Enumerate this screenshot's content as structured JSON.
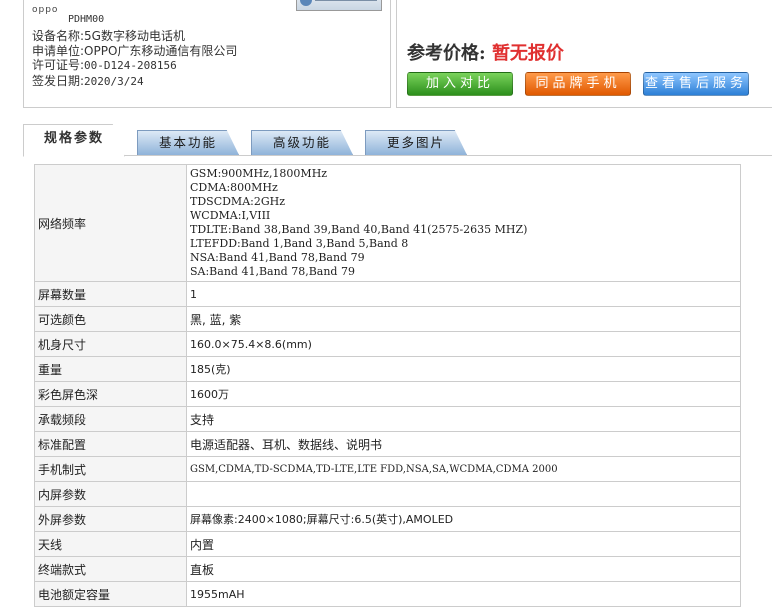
{
  "header": {
    "brand_logo": "oppo",
    "model": "PDHM00",
    "info": [
      {
        "label": "设备名称:",
        "value": "5G数字移动电话机"
      },
      {
        "label": "申请单位:",
        "value": "OPPO广东移动通信有限公司"
      },
      {
        "label": "许可证号:",
        "value": "00-D124-208156"
      },
      {
        "label": "签发日期:",
        "value": "2020/3/24"
      }
    ]
  },
  "price": {
    "label": "参考价格:",
    "value": "暂无报价"
  },
  "buttons": {
    "compare": "加入对比",
    "brand": "同品牌手机",
    "service": "查看售后服务"
  },
  "tabs": [
    "规格参数",
    "基本功能",
    "高级功能",
    "更多图片"
  ],
  "specs": [
    {
      "key": "网络频率",
      "value": "GSM:900MHz,1800MHz\nCDMA:800MHz\nTDSCDMA:2GHz\nWCDMA:I,VIII\nTDLTE:Band 38,Band 39,Band 40,Band 41(2575-2635 MHZ)\nLTEFDD:Band 1,Band 3,Band 5,Band 8\nNSA:Band 41,Band 78,Band 79\nSA:Band 41,Band 78,Band 79"
    },
    {
      "key": "屏幕数量",
      "value": "1"
    },
    {
      "key": "可选颜色",
      "value": "黑, 蓝, 紫"
    },
    {
      "key": "机身尺寸",
      "value": "160.0×75.4×8.6(mm)"
    },
    {
      "key": "重量",
      "value": "185(克)"
    },
    {
      "key": "彩色屏色深",
      "value": "1600万"
    },
    {
      "key": "承载频段",
      "value": "支持"
    },
    {
      "key": "标准配置",
      "value": "电源适配器、耳机、数据线、说明书"
    },
    {
      "key": "手机制式",
      "value": "GSM,CDMA,TD-SCDMA,TD-LTE,LTE FDD,NSA,SA,WCDMA,CDMA 2000"
    },
    {
      "key": "内屏参数",
      "value": ""
    },
    {
      "key": "外屏参数",
      "value": "屏幕像素:2400×1080;屏幕尺寸:6.5(英寸),AMOLED"
    },
    {
      "key": "天线",
      "value": "内置"
    },
    {
      "key": "终端款式",
      "value": "直板"
    },
    {
      "key": "电池额定容量",
      "value": "1955mAH"
    }
  ]
}
